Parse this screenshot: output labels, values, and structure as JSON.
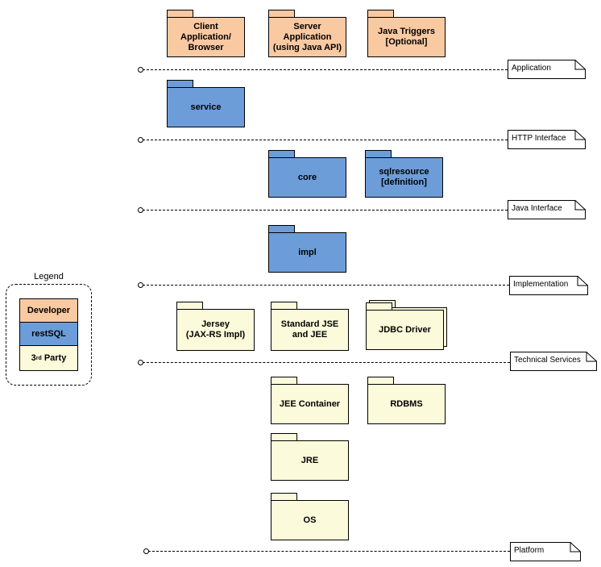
{
  "colors": {
    "developer": "#f9c9a2",
    "restsql": "#6d9dd9",
    "third_party": "#fbfbdb"
  },
  "layers": [
    {
      "label": "Application"
    },
    {
      "label": "HTTP Interface"
    },
    {
      "label": "Java Interface"
    },
    {
      "label": "Implementation"
    },
    {
      "label": "Technical Services"
    },
    {
      "label": "Platform"
    }
  ],
  "packages": {
    "client_app": {
      "label": "Client\nApplication/\nBrowser",
      "category": "Developer"
    },
    "server_app": {
      "label": "Server\nApplication\n(using Java API)",
      "category": "Developer"
    },
    "java_triggers": {
      "label": "Java Triggers\n[Optional]",
      "category": "Developer"
    },
    "service": {
      "label": "service",
      "category": "restSQL"
    },
    "core": {
      "label": "core",
      "category": "restSQL"
    },
    "sqlresource": {
      "label": "sqlresource\n[definition]",
      "category": "restSQL"
    },
    "impl": {
      "label": "impl",
      "category": "restSQL"
    },
    "jersey": {
      "label": "Jersey\n(JAX-RS Impl)",
      "category": "3rd Party"
    },
    "standard_jse": {
      "label": "Standard JSE\nand JEE",
      "category": "3rd Party"
    },
    "jdbc_driver": {
      "label": "JDBC Driver",
      "category": "3rd Party"
    },
    "jee_container": {
      "label": "JEE Container",
      "category": "3rd Party"
    },
    "rdbms": {
      "label": "RDBMS",
      "category": "3rd Party"
    },
    "jre": {
      "label": "JRE",
      "category": "3rd Party"
    },
    "os": {
      "label": "OS",
      "category": "3rd Party"
    }
  },
  "legend": {
    "title": "Legend",
    "items": [
      {
        "label": "Developer"
      },
      {
        "label": "restSQL"
      },
      {
        "label_main": "3",
        "label_sup": "rd",
        "label_rest": " Party"
      }
    ]
  }
}
